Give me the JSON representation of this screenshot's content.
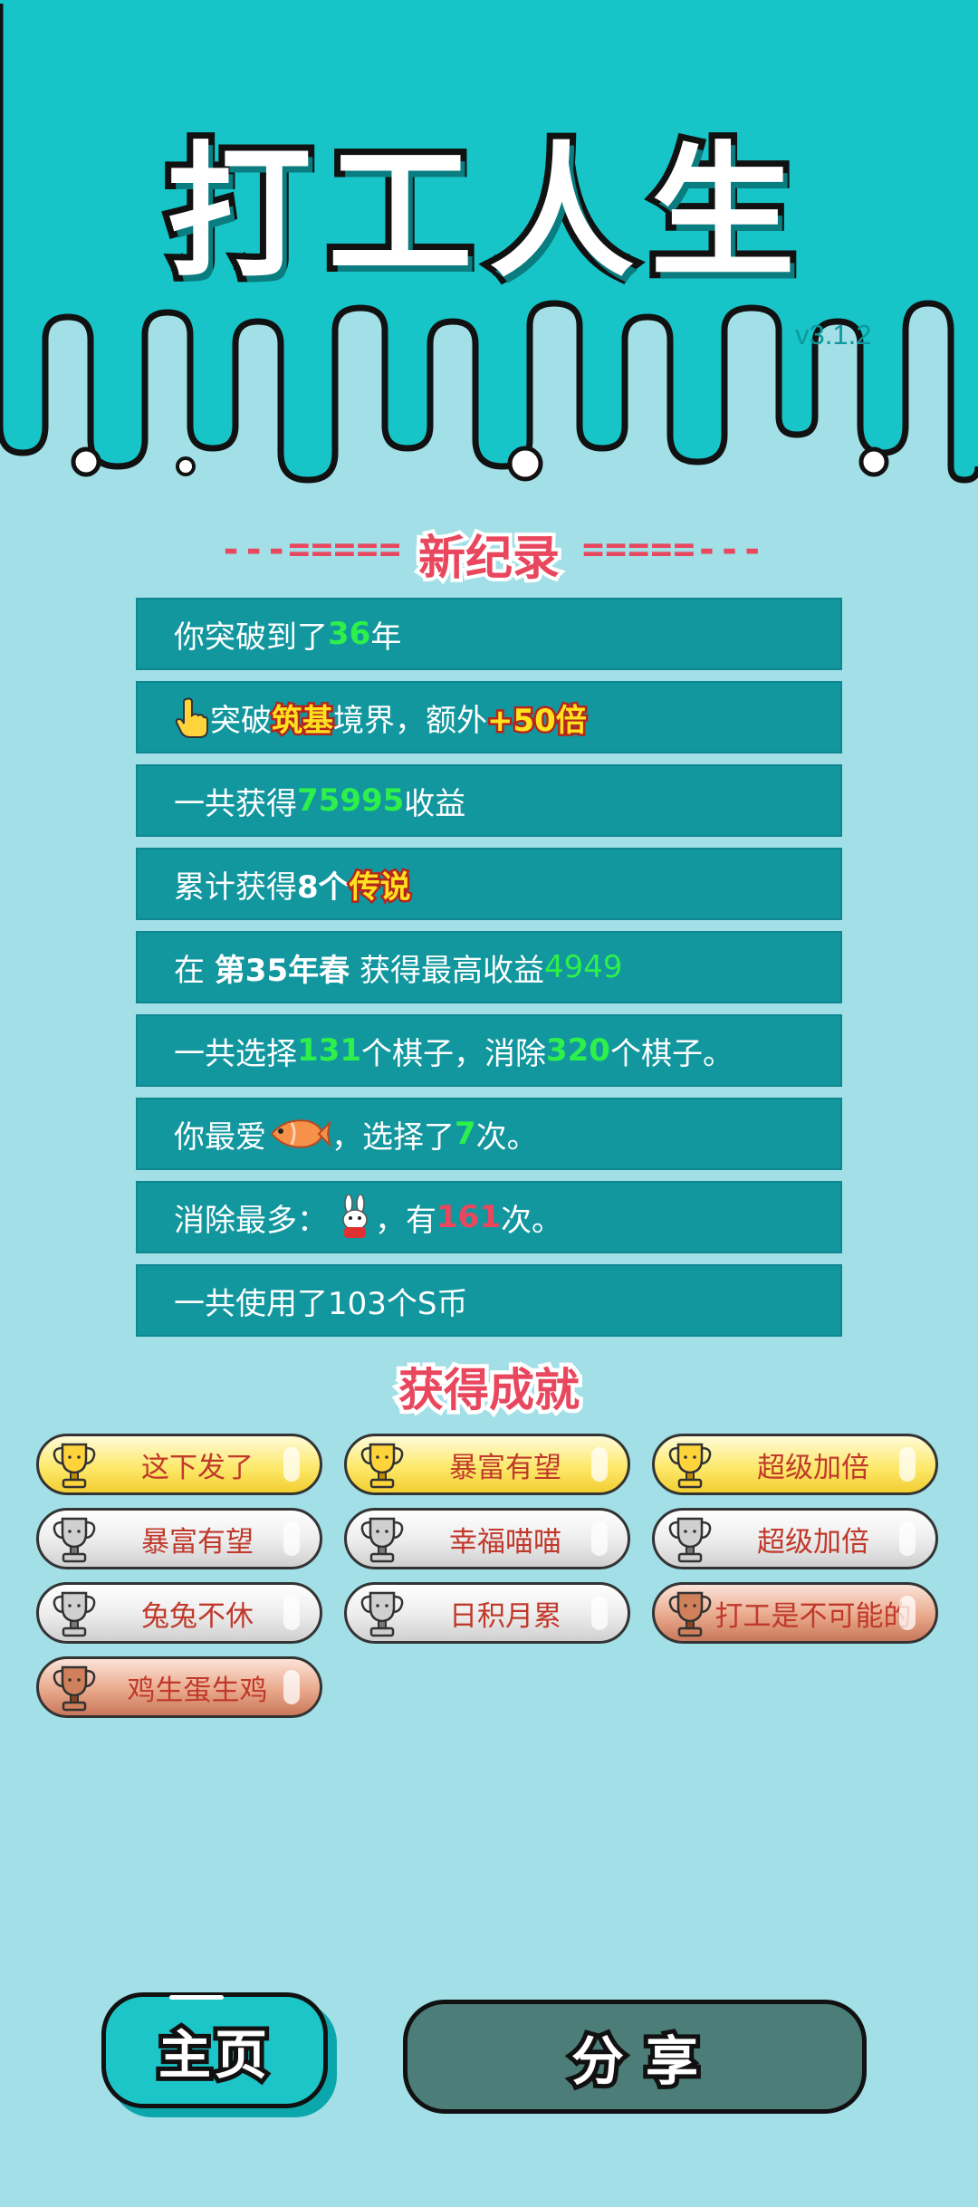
{
  "header": {
    "title": "打工人生",
    "version": "v3.1.2"
  },
  "record": {
    "heading": "新纪录",
    "dashes_left": "---=====",
    "dashes_right": "=====---"
  },
  "rows": {
    "r1": {
      "a": "你突破到了",
      "b": "36",
      "c": "年"
    },
    "r2": {
      "a": "突破",
      "b": "筑基",
      "c": "境界，额外",
      "d": "+50倍"
    },
    "r3": {
      "a": "一共获得",
      "b": "75995",
      "c": "收益"
    },
    "r4": {
      "a": "累计获得",
      "b": "8个",
      "c": "传说"
    },
    "r5": {
      "a": "在 ",
      "b": "第35年春",
      "c": " 获得最高收益",
      "d": "4949"
    },
    "r6": {
      "a": "一共选择",
      "b": "131",
      "c": "个棋子，消除",
      "d": "320",
      "e": "个棋子。"
    },
    "r7": {
      "a": "你最爱",
      "c": "，选择了",
      "d": "7",
      "e": "次。"
    },
    "r8": {
      "a": "消除最多：",
      "c": "，有",
      "d": "161",
      "e": "次。"
    },
    "r9": {
      "a": "一共使用了103个S币"
    }
  },
  "icons": {
    "pointer": "pointing-hand-icon",
    "fish": "fish-icon",
    "rabbit": "rabbit-icon",
    "trophy": "trophy-icon"
  },
  "achievements": {
    "title": "获得成就",
    "items": [
      {
        "label": "这下发了",
        "tier": "gold"
      },
      {
        "label": "暴富有望",
        "tier": "gold"
      },
      {
        "label": "超级加倍",
        "tier": "gold"
      },
      {
        "label": "暴富有望",
        "tier": "silver"
      },
      {
        "label": "幸福喵喵",
        "tier": "silver"
      },
      {
        "label": "超级加倍",
        "tier": "silver"
      },
      {
        "label": "兔兔不休",
        "tier": "silver"
      },
      {
        "label": "日积月累",
        "tier": "silver"
      },
      {
        "label": "打工是不可能的",
        "tier": "bronze"
      },
      {
        "label": "鸡生蛋生鸡",
        "tier": "bronze"
      }
    ]
  },
  "buttons": {
    "home": "主页",
    "share": "分享"
  },
  "colors": {
    "background": "#a2dfe6",
    "header_teal": "#17c5c8",
    "row_teal": "#12979f",
    "accent_green": "#2df04a",
    "accent_red": "#e8475e",
    "accent_yellow": "#ffe11e",
    "share_button": "#4c7d78"
  }
}
